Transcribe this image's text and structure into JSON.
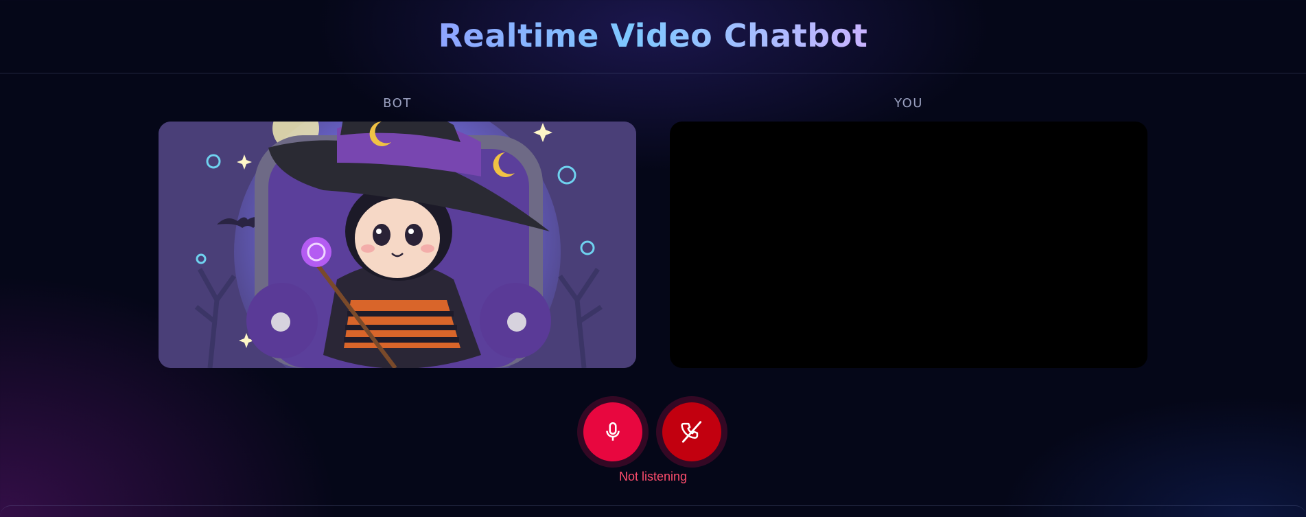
{
  "app": {
    "title": "Realtime Video Chatbot"
  },
  "panels": {
    "bot": {
      "label": "BOT"
    },
    "user": {
      "label": "YOU"
    }
  },
  "controls": {
    "mic_icon": "microphone-icon",
    "hangup_icon": "phone-off-icon",
    "status": "Not listening"
  },
  "colors": {
    "mic_button": "#e8073f",
    "hangup_button": "#c2000f",
    "status_text": "#ff4d6d",
    "background": "#050718"
  }
}
